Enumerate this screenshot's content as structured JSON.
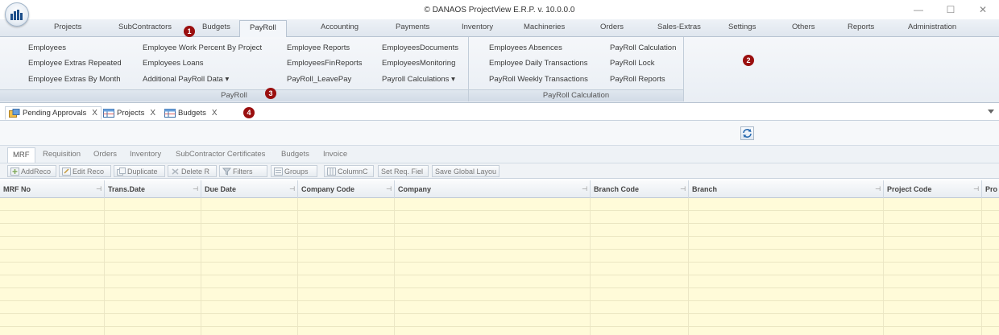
{
  "window": {
    "title": "© DANAOS ProjectView E.R.P. v. 10.0.0.0",
    "controls": [
      "—",
      "☐",
      "✕"
    ]
  },
  "menu_tabs": [
    "Projects",
    "SubContractors",
    "Budgets",
    "PayRoll",
    "Accounting",
    "Payments",
    "Inventory",
    "Machineries",
    "Orders",
    "Sales-Extras",
    "Settings",
    "Others",
    "Reports",
    "Administration"
  ],
  "active_menu_tab": "PayRoll",
  "ribbon": {
    "payroll_group": {
      "label": "PayRoll",
      "col1": [
        "Employees",
        "Employee Extras Repeated",
        "Employee Extras By Month"
      ],
      "col2": [
        "Employee Work Percent By Project",
        "Employees Loans",
        "Additional PayRoll Data ▾"
      ],
      "col3": [
        "Employee Reports",
        "EmployeesFinReports",
        "PayRoll_LeavePay"
      ],
      "col4": [
        "EmployeesDocuments",
        "EmployeesMonitoring",
        "Payroll Calculations ▾"
      ]
    },
    "calc_group": {
      "label": "PayRoll Calculation",
      "col1": [
        "Employees Absences",
        "Employee Daily Transactions",
        "PayRoll Weekly Transactions"
      ],
      "col2": [
        "PayRoll Calculation",
        "PayRoll Lock",
        "PayRoll Reports"
      ]
    }
  },
  "badges": [
    "1",
    "2",
    "3",
    "4"
  ],
  "doc_tabs": [
    {
      "label": "Pending Approvals",
      "close": "X"
    },
    {
      "label": "Projects",
      "close": "X"
    },
    {
      "label": "Budgets",
      "close": "X"
    }
  ],
  "sub_tabs": [
    "MRF",
    "Requisition",
    "Orders",
    "Inventory",
    "SubContractor Certificates",
    "Budgets",
    "Invoice"
  ],
  "toolbar": [
    "AddReco",
    "Edit Reco",
    "Duplicate",
    "Delete R",
    "Filters",
    "Groups",
    "ColumnC",
    "Set Req. Fiel",
    "Save Global Layou"
  ],
  "grid_columns": [
    "MRF No",
    "Trans.Date",
    "Due Date",
    "Company Code",
    "Company",
    "Branch Code",
    "Branch",
    "Project Code",
    "Pro"
  ],
  "grid_pin": "⊣"
}
